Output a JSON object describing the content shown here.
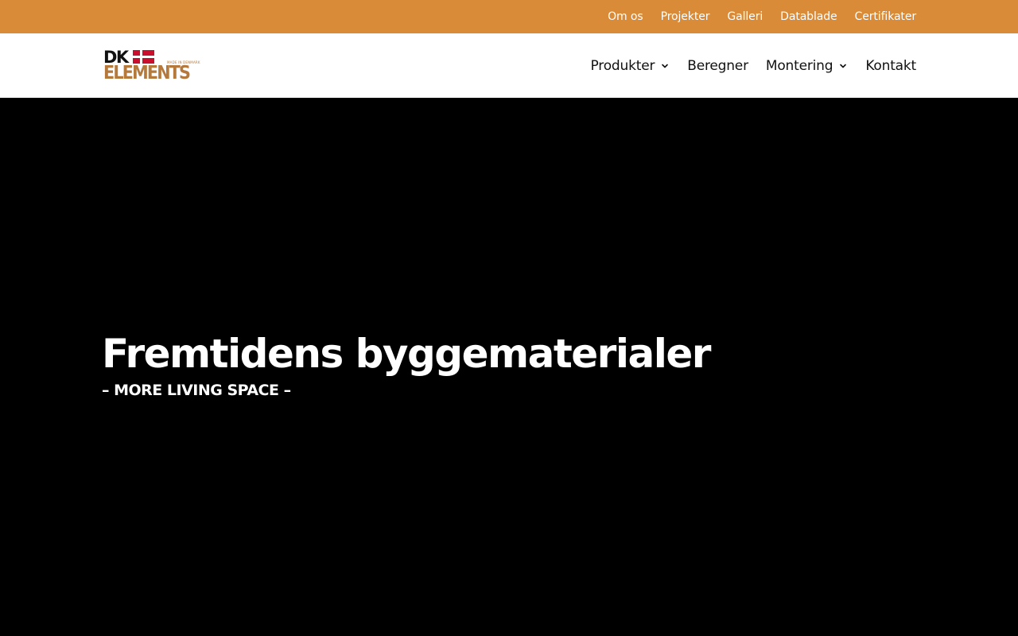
{
  "colors": {
    "topbar_bg": "#d98b38",
    "header_bg": "#ffffff",
    "hero_bg": "#000000",
    "brand_copper": "#b5793c",
    "flag_red": "#c8102e"
  },
  "topbar": {
    "links": [
      "Om os",
      "Projekter",
      "Galleri",
      "Datablade",
      "Certifikater"
    ]
  },
  "logo": {
    "top": "DK",
    "bottom": "ELEMENTS",
    "tagline": "MADE IN DENMARK",
    "flag_icon": "danish-flag-icon"
  },
  "nav": {
    "items": [
      {
        "label": "Produkter",
        "icon": "chevron-down-icon"
      },
      {
        "label": "Beregner"
      },
      {
        "label": "Montering",
        "icon": "chevron-down-icon"
      },
      {
        "label": "Kontakt"
      }
    ]
  },
  "hero": {
    "title": "Fremtidens byggematerialer",
    "subtitle": "– MORE LIVING SPACE –"
  }
}
